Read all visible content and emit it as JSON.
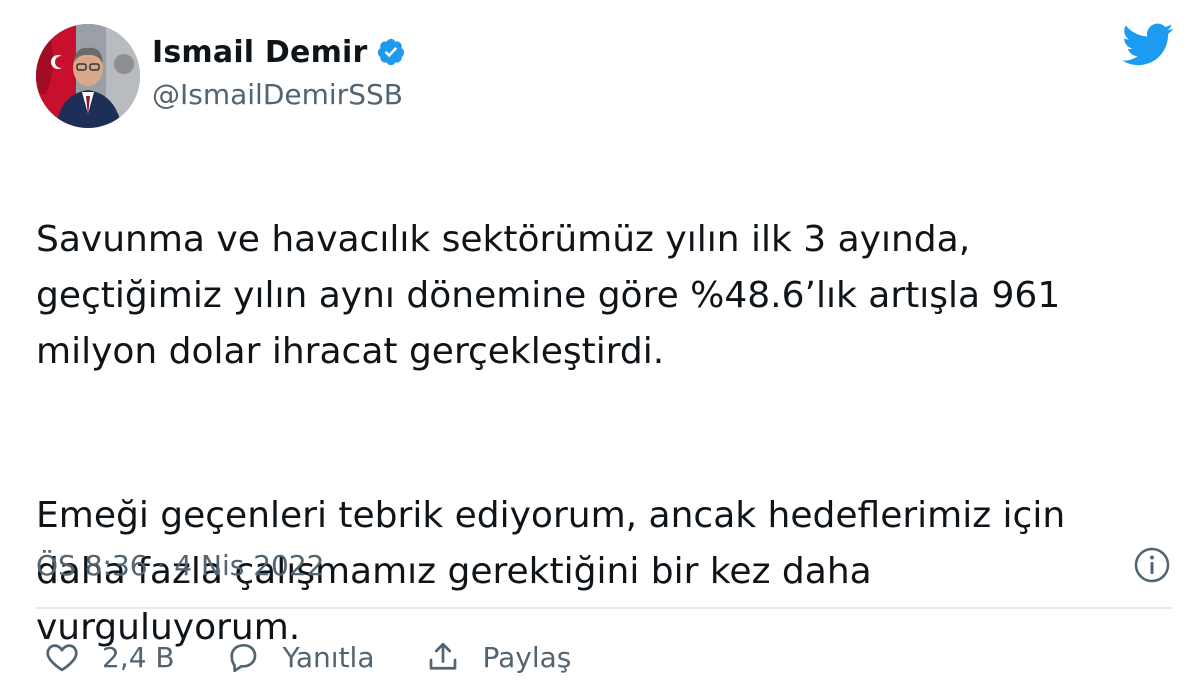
{
  "author": {
    "display_name": "Ismail Demir",
    "handle": "@IsmailDemirSSB",
    "verified": true
  },
  "tweet": {
    "paragraphs": [
      "Savunma ve havacılık sektörümüz yılın ilk 3 ayında,\ngeçtiğimiz yılın aynı dönemine göre %48.6’lık artışla 961\nmilyon dolar ihracat gerçekleştirdi.",
      "Emeği geçenleri tebrik ediyorum, ancak hedeflerimiz için\ndaha fazla çalışmamız gerektiğini bir kez daha\nvurguluyorum."
    ],
    "timestamp": "ÖS 8:36 · 4 Nis 2022"
  },
  "actions": {
    "like_count": "2,4 B",
    "reply_label": "Yanıtla",
    "share_label": "Paylaş"
  },
  "colors": {
    "brand_blue": "#1d9bf0",
    "secondary_text": "#536471",
    "primary_text": "#0f1419"
  },
  "icons": {
    "verified": "verified-badge-icon",
    "brand": "twitter-bird-icon",
    "info": "info-icon",
    "like": "heart-icon",
    "reply": "speech-bubble-icon",
    "share": "share-arrow-icon"
  }
}
